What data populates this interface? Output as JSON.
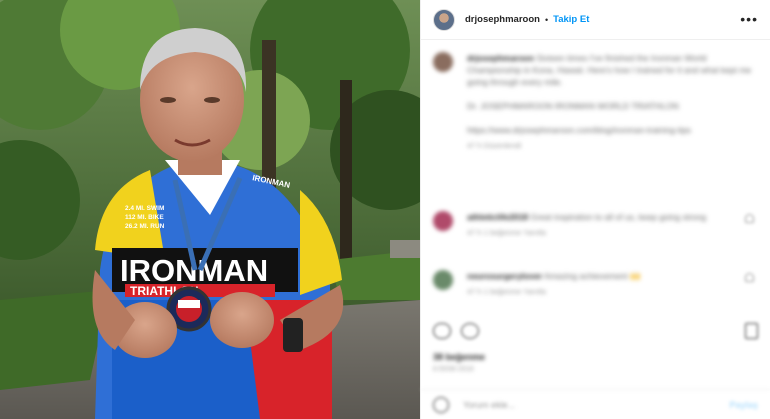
{
  "header": {
    "username": "drjosephmaroon",
    "separator": "•",
    "follow_label": "Takip Et",
    "more_icon": "more-horizontal-icon"
  },
  "photo": {
    "jersey_text": "IRONMAN",
    "jersey_sub": "TRIATHLON",
    "jersey_lines": [
      "2.4 MI. SWIM",
      "112 MI. BIKE",
      "26.2 MI. RUN"
    ],
    "collar_text": "IRONMAN"
  },
  "caption": {
    "user": "drjosephmaroon",
    "text": "Sixteen times I've finished the Ironman World Championship in Kona, Hawaii. Here's how I trained for it and what kept me going through every mile.",
    "paragraph2": "Dr. JOSEPHMAROON IRONMAN WORLD TRIATHLON",
    "paragraph3": "https://www.drjosephmaroon.com/blog/ironman-training-tips",
    "time": "47 h   Düzenlendi"
  },
  "comments": [
    {
      "user": "athleticlife2018",
      "text": "Great inspiration to all of us, keep going strong",
      "meta": "47 h   1 beğenme   Yanıtla"
    },
    {
      "user": "neurosurgerylover",
      "text": "Amazing achievement 🙌",
      "meta": "47 h   1 beğenme   Yanıtla"
    }
  ],
  "likes": "38 beğenme",
  "date": "8 EKİM 2018",
  "add_comment": {
    "placeholder": "Yorum ekle...",
    "share": "Paylaş"
  }
}
